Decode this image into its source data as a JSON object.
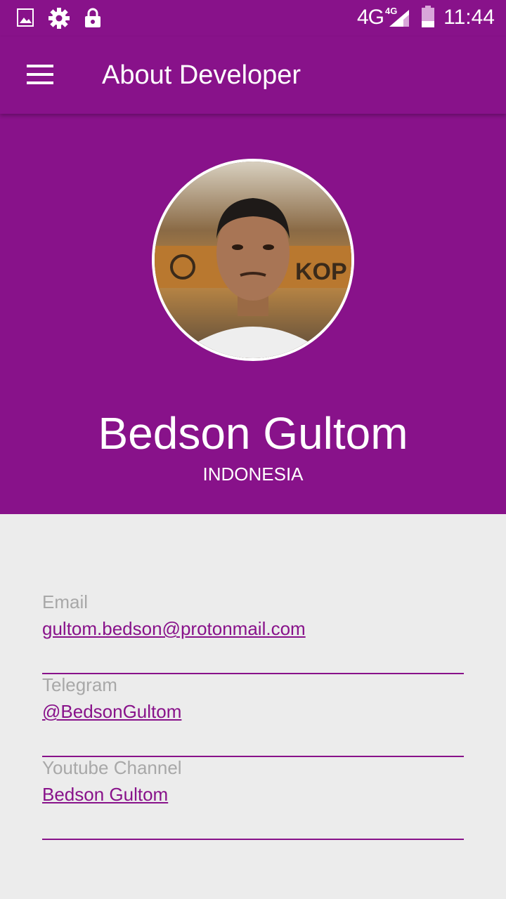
{
  "status_bar": {
    "network": "4G",
    "network_sup": "4G",
    "time": "11:44",
    "icons": [
      "image-icon",
      "gear-icon",
      "lock-icon",
      "signal-icon",
      "battery-icon"
    ]
  },
  "app_bar": {
    "title": "About Developer",
    "menu_icon": "hamburger-menu-icon"
  },
  "profile": {
    "name": "Bedson Gultom",
    "country": "INDONESIA"
  },
  "contacts": [
    {
      "label": "Email",
      "value": "gultom.bedson@protonmail.com"
    },
    {
      "label": "Telegram",
      "value": "@BedsonGultom"
    },
    {
      "label": "Youtube Channel",
      "value": "Bedson Gultom"
    }
  ],
  "colors": {
    "primary": "#88128a",
    "background": "#ececec",
    "label": "#a8a8a8"
  }
}
